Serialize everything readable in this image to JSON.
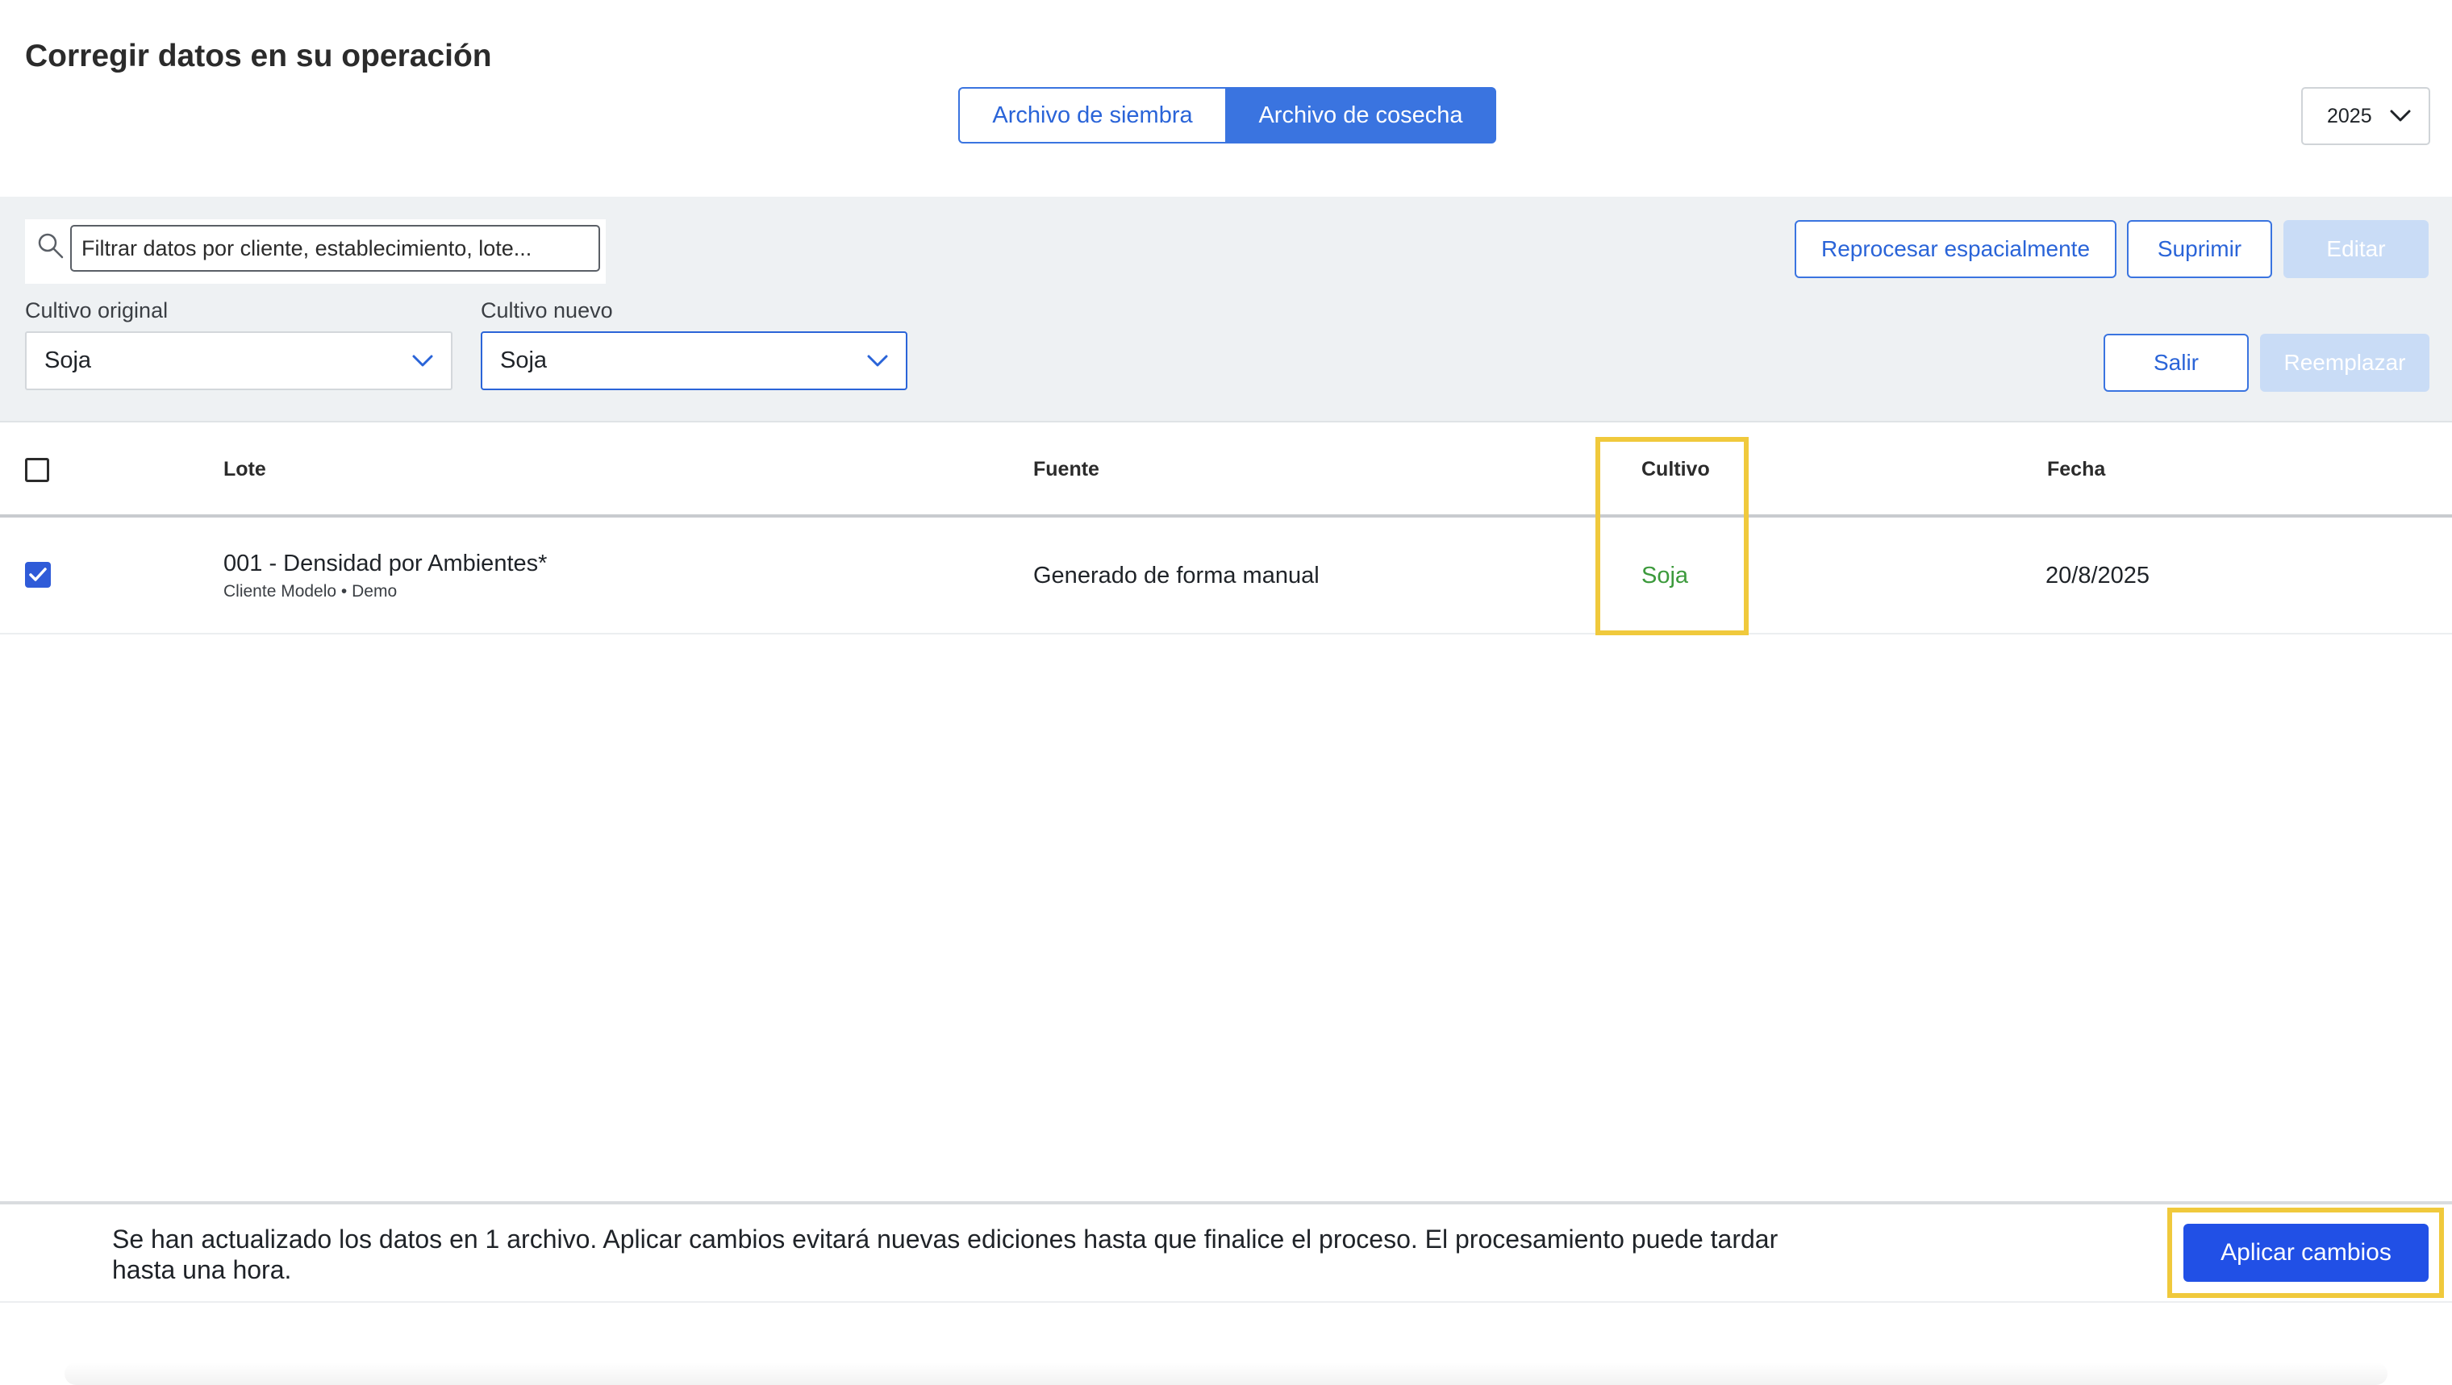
{
  "header": {
    "title": "Corregir datos en su operación",
    "tabs": [
      {
        "label": "Archivo de siembra",
        "active": false
      },
      {
        "label": "Archivo de cosecha",
        "active": true
      }
    ],
    "year": "2025"
  },
  "filters": {
    "search_placeholder": "Filtrar datos por cliente, establecimiento, lote...",
    "original_crop_label": "Cultivo original",
    "original_crop_value": "Soja",
    "new_crop_label": "Cultivo nuevo",
    "new_crop_value": "Soja"
  },
  "actions": {
    "reprocess": "Reprocesar espacialmente",
    "delete": "Suprimir",
    "edit": "Editar",
    "exit": "Salir",
    "replace": "Reemplazar"
  },
  "table": {
    "columns": [
      "Lote",
      "Fuente",
      "Cultivo",
      "Fecha"
    ],
    "rows": [
      {
        "checked": true,
        "lote": "001 - Densidad por Ambientes*",
        "lote_sub": "Cliente Modelo • Demo",
        "fuente": "Generado de forma manual",
        "cultivo": "Soja",
        "fecha": "20/8/2025"
      }
    ]
  },
  "footer": {
    "message": "Se han actualizado los datos en 1 archivo. Aplicar cambios evitará nuevas ediciones hasta que finalice el proceso. El procesamiento puede tardar hasta una hora.",
    "apply": "Aplicar cambios"
  },
  "colors": {
    "accent": "#3a74e0",
    "apply_button": "#2150e6",
    "crop_text": "#3c9a3c",
    "highlight": "#f0c93c"
  }
}
